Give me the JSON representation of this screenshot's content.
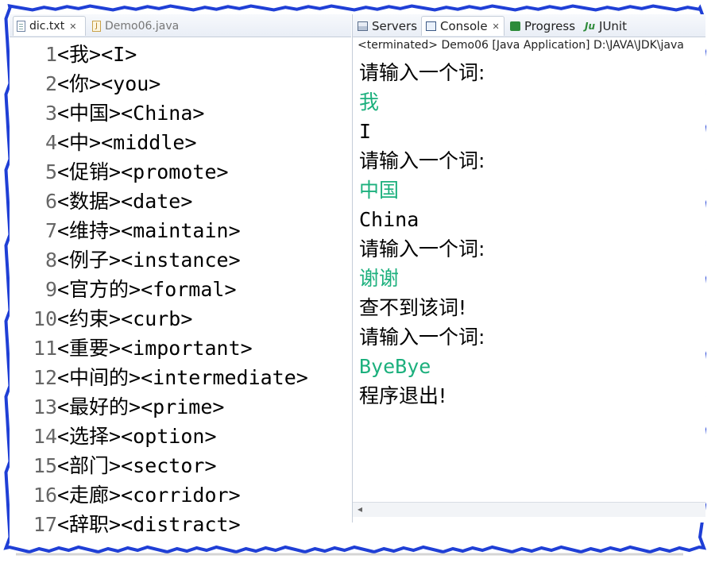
{
  "editor": {
    "tabs": [
      {
        "label": "dic.txt",
        "active": true
      },
      {
        "label": "Demo06.java",
        "active": false
      }
    ],
    "lines": [
      {
        "no": "1",
        "text": "<我><I>"
      },
      {
        "no": "2",
        "text": "<你><you>"
      },
      {
        "no": "3",
        "text": "<中国><China>"
      },
      {
        "no": "4",
        "text": "<中><middle>"
      },
      {
        "no": "5",
        "text": "<促销><promote>"
      },
      {
        "no": "6",
        "text": "<数据><date>"
      },
      {
        "no": "7",
        "text": "<维持><maintain>"
      },
      {
        "no": "8",
        "text": "<例子><instance>"
      },
      {
        "no": "9",
        "text": "<官方的><formal>"
      },
      {
        "no": "10",
        "text": "<约束><curb>"
      },
      {
        "no": "11",
        "text": "<重要><important>"
      },
      {
        "no": "12",
        "text": "<中间的><intermediate>"
      },
      {
        "no": "13",
        "text": "<最好的><prime>"
      },
      {
        "no": "14",
        "text": "<选择><option>"
      },
      {
        "no": "15",
        "text": "<部门><sector>"
      },
      {
        "no": "16",
        "text": "<走廊><corridor>"
      },
      {
        "no": "17",
        "text": "<辞职><distract>"
      }
    ]
  },
  "console": {
    "tabs": [
      {
        "label": "Servers",
        "icon": "servers-icon"
      },
      {
        "label": "Console",
        "icon": "console-icon",
        "active": true
      },
      {
        "label": "Progress",
        "icon": "progress-icon"
      },
      {
        "label": "JUnit",
        "icon": "junit-icon"
      }
    ],
    "status": "<terminated> Demo06 [Java Application] D:\\JAVA\\JDK\\java",
    "lines": [
      {
        "text": "请输入一个词:",
        "kind": "prompt"
      },
      {
        "text": "我",
        "kind": "input"
      },
      {
        "text": "I",
        "kind": "output"
      },
      {
        "text": "请输入一个词:",
        "kind": "prompt"
      },
      {
        "text": "中国",
        "kind": "input"
      },
      {
        "text": "China",
        "kind": "output"
      },
      {
        "text": "请输入一个词:",
        "kind": "prompt"
      },
      {
        "text": "谢谢",
        "kind": "input"
      },
      {
        "text": "查不到该词!",
        "kind": "prompt"
      },
      {
        "text": "请输入一个词:",
        "kind": "prompt"
      },
      {
        "text": "ByeBye",
        "kind": "input"
      },
      {
        "text": "程序退出!",
        "kind": "prompt"
      }
    ]
  },
  "colors": {
    "frame": "#1f3fd6",
    "user_input": "#1cb07d"
  }
}
